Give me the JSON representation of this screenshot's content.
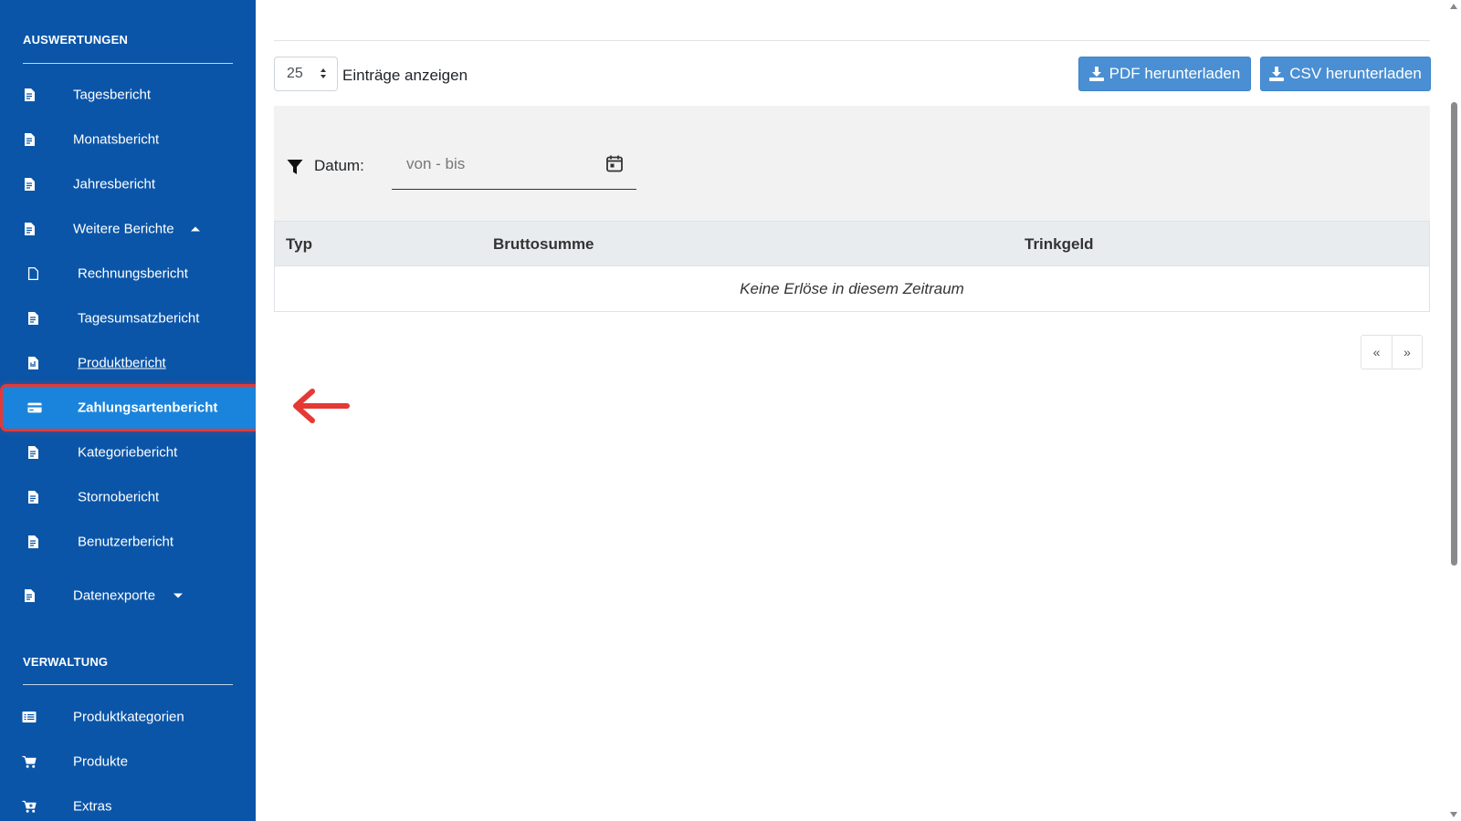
{
  "sidebar": {
    "section_reports": "AUSWERTUNGEN",
    "section_admin": "VERWALTUNG",
    "items": [
      {
        "label": "Tagesbericht",
        "icon": "report-file-icon"
      },
      {
        "label": "Monatsbericht",
        "icon": "report-file-icon"
      },
      {
        "label": "Jahresbericht",
        "icon": "report-file-icon"
      },
      {
        "label": "Weitere Berichte",
        "icon": "report-file-icon",
        "expanded": true
      },
      {
        "label": "Rechnungsbericht",
        "icon": "file-icon"
      },
      {
        "label": "Tagesumsatzbericht",
        "icon": "report-file-icon"
      },
      {
        "label": "Produktbericht",
        "icon": "report-file-icon"
      },
      {
        "label": "Zahlungsartenbericht",
        "icon": "credit-card-icon",
        "active": true
      },
      {
        "label": "Kategoriebericht",
        "icon": "report-file-icon"
      },
      {
        "label": "Stornobericht",
        "icon": "report-file-icon"
      },
      {
        "label": "Benutzerbericht",
        "icon": "report-file-icon"
      },
      {
        "label": "Datenexporte",
        "icon": "report-file-icon",
        "expanded": false
      }
    ],
    "admin_items": [
      {
        "label": "Produktkategorien",
        "icon": "list-icon"
      },
      {
        "label": "Produkte",
        "icon": "cart-icon"
      },
      {
        "label": "Extras",
        "icon": "cart-plus-icon"
      }
    ]
  },
  "toolbar": {
    "page_length": "25",
    "page_length_label": "Einträge anzeigen",
    "pdf_button": "PDF herunterladen",
    "csv_button": "CSV herunterladen"
  },
  "filter": {
    "label": "Datum:",
    "date_placeholder": "von - bis"
  },
  "table": {
    "columns": [
      "Typ",
      "Bruttosumme",
      "Trinkgeld"
    ],
    "empty_message": "Keine Erlöse in diesem Zeitraum"
  },
  "pagination": {
    "prev": "«",
    "next": "»"
  },
  "colors": {
    "sidebar_bg": "#0a55a8",
    "active_bg": "#1a84dc",
    "highlight": "#e53935",
    "button_bg": "#4a8fd3"
  }
}
